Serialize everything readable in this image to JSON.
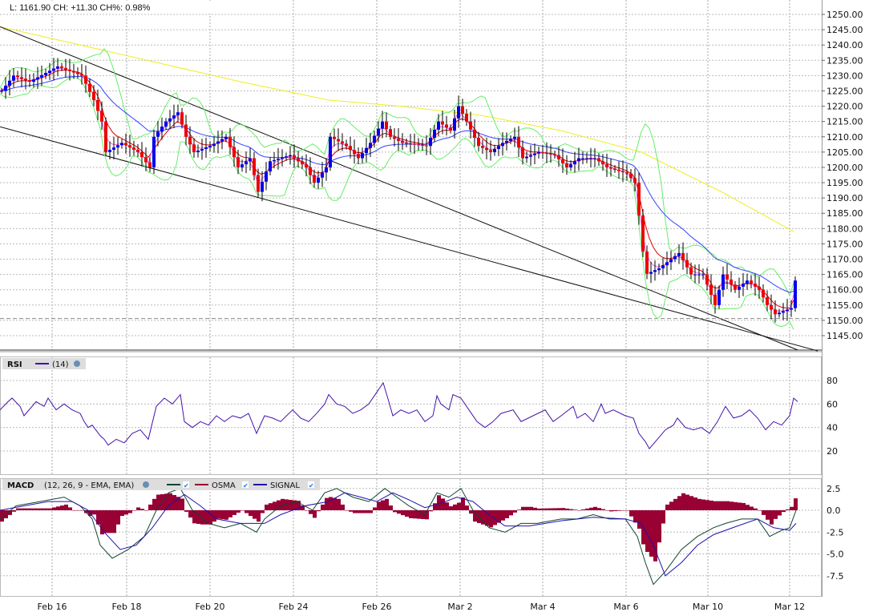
{
  "header": {
    "quote": "L: 1161.90 CH: +11.30 CH%: 0.98%"
  },
  "rsi_legend": {
    "title": "RSI",
    "params": "(14)"
  },
  "macd_legend": {
    "title": "MACD",
    "params": "(12, 26, 9 - EMA, EMA)",
    "osma": "OSMA",
    "signal": "SIGNAL"
  },
  "colors": {
    "up": "#0000ee",
    "down": "#ee0000",
    "ema_fast": "#dd0000",
    "ema_slow": "#3344ff",
    "sma_long": "#eeee22",
    "bands": "#66ee66",
    "rsi": "#4411aa",
    "macd": "#114433",
    "signal": "#2211aa",
    "osma": "#990033"
  },
  "chart_data": [
    {
      "type": "candlestick",
      "title": "Price",
      "xunit": "bar index",
      "price_ticks": [
        "1250.00",
        "1245.00",
        "1240.00",
        "1235.00",
        "1230.00",
        "1225.00",
        "1220.00",
        "1215.00",
        "1210.00",
        "1205.00",
        "1200.00",
        "1195.00",
        "1190.00",
        "1185.00",
        "1180.00",
        "1175.00",
        "1170.00",
        "1165.00",
        "1160.00",
        "1155.00",
        "1150.00",
        "1145.00"
      ],
      "ylim": [
        1140,
        1252
      ],
      "close": [
        [
          0,
          1225
        ],
        [
          3,
          1230
        ],
        [
          7,
          1228
        ],
        [
          14,
          1233
        ],
        [
          20,
          1230
        ],
        [
          23,
          1222
        ],
        [
          25,
          1215
        ],
        [
          26,
          1205
        ],
        [
          30,
          1208
        ],
        [
          34,
          1205
        ],
        [
          37,
          1200
        ],
        [
          38,
          1210
        ],
        [
          41,
          1215
        ],
        [
          44,
          1218
        ],
        [
          46,
          1210
        ],
        [
          48,
          1205
        ],
        [
          52,
          1207
        ],
        [
          56,
          1210
        ],
        [
          59,
          1200
        ],
        [
          62,
          1203
        ],
        [
          64,
          1192
        ],
        [
          67,
          1202
        ],
        [
          72,
          1204
        ],
        [
          76,
          1200
        ],
        [
          78,
          1195
        ],
        [
          81,
          1200
        ],
        [
          82,
          1210
        ],
        [
          86,
          1207
        ],
        [
          89,
          1203
        ],
        [
          92,
          1208
        ],
        [
          95,
          1215
        ],
        [
          97,
          1210
        ],
        [
          100,
          1208
        ],
        [
          106,
          1207
        ],
        [
          109,
          1215
        ],
        [
          112,
          1212
        ],
        [
          114,
          1220
        ],
        [
          116,
          1215
        ],
        [
          119,
          1207
        ],
        [
          122,
          1205
        ],
        [
          125,
          1208
        ],
        [
          128,
          1210
        ],
        [
          130,
          1203
        ],
        [
          134,
          1205
        ],
        [
          138,
          1204
        ],
        [
          141,
          1200
        ],
        [
          144,
          1203
        ],
        [
          148,
          1203
        ],
        [
          151,
          1200
        ],
        [
          156,
          1198
        ],
        [
          158,
          1195
        ],
        [
          159.4,
          1180
        ],
        [
          160.6,
          1165
        ],
        [
          164,
          1167
        ],
        [
          169,
          1172
        ],
        [
          172,
          1165
        ],
        [
          175,
          1165
        ],
        [
          178,
          1155
        ],
        [
          180,
          1165
        ],
        [
          183,
          1160
        ],
        [
          186,
          1163
        ],
        [
          189,
          1160
        ],
        [
          191,
          1155
        ],
        [
          193,
          1152
        ],
        [
          195,
          1153
        ],
        [
          197,
          1154
        ],
        [
          198,
          1163
        ]
      ],
      "sma_long": [
        [
          0,
          1246
        ],
        [
          30,
          1237
        ],
        [
          60,
          1228
        ],
        [
          82,
          1222
        ],
        [
          100,
          1220
        ],
        [
          120,
          1217
        ],
        [
          140,
          1212
        ],
        [
          160,
          1205
        ],
        [
          180,
          1192
        ],
        [
          198,
          1179
        ]
      ],
      "trendlines": [
        [
          [
            0,
            1246
          ],
          [
            199,
            1140.3
          ]
        ],
        [
          [
            0,
            1213.3
          ],
          [
            204,
            1140
          ]
        ]
      ],
      "prev_close": 1150.6
    },
    {
      "type": "line",
      "title": "RSI (14)",
      "ylim": [
        0,
        100
      ],
      "ticks": [
        "80",
        "60",
        "40",
        "20"
      ],
      "values": [
        [
          0,
          55
        ],
        [
          2,
          62
        ],
        [
          3,
          65
        ],
        [
          5,
          58
        ],
        [
          6,
          50
        ],
        [
          9,
          62
        ],
        [
          11,
          58
        ],
        [
          12,
          65
        ],
        [
          14,
          55
        ],
        [
          16,
          60
        ],
        [
          18,
          55
        ],
        [
          20,
          52
        ],
        [
          21,
          45
        ],
        [
          22,
          40
        ],
        [
          23,
          42
        ],
        [
          25,
          33
        ],
        [
          26,
          30
        ],
        [
          27,
          25
        ],
        [
          29,
          30
        ],
        [
          31,
          27
        ],
        [
          33,
          35
        ],
        [
          35,
          38
        ],
        [
          37,
          30
        ],
        [
          39,
          58
        ],
        [
          41,
          65
        ],
        [
          43,
          60
        ],
        [
          45,
          68
        ],
        [
          46,
          45
        ],
        [
          48,
          40
        ],
        [
          50,
          45
        ],
        [
          52,
          42
        ],
        [
          54,
          50
        ],
        [
          56,
          45
        ],
        [
          58,
          50
        ],
        [
          60,
          48
        ],
        [
          62,
          52
        ],
        [
          64,
          35
        ],
        [
          66,
          50
        ],
        [
          68,
          48
        ],
        [
          70,
          45
        ],
        [
          73,
          55
        ],
        [
          75,
          48
        ],
        [
          77,
          45
        ],
        [
          79,
          52
        ],
        [
          81,
          60
        ],
        [
          82,
          68
        ],
        [
          84,
          60
        ],
        [
          86,
          58
        ],
        [
          88,
          52
        ],
        [
          90,
          55
        ],
        [
          92,
          60
        ],
        [
          94,
          70
        ],
        [
          95.6,
          78
        ],
        [
          97,
          62
        ],
        [
          98,
          50
        ],
        [
          100,
          55
        ],
        [
          102,
          52
        ],
        [
          104,
          55
        ],
        [
          106,
          45
        ],
        [
          108,
          50
        ],
        [
          109,
          67
        ],
        [
          110,
          60
        ],
        [
          112,
          55
        ],
        [
          113,
          68
        ],
        [
          115,
          65
        ],
        [
          117,
          55
        ],
        [
          119,
          45
        ],
        [
          121,
          40
        ],
        [
          123,
          45
        ],
        [
          125,
          52
        ],
        [
          128,
          55
        ],
        [
          130,
          45
        ],
        [
          133,
          50
        ],
        [
          136,
          55
        ],
        [
          138,
          45
        ],
        [
          140,
          50
        ],
        [
          143,
          58
        ],
        [
          144,
          48
        ],
        [
          146,
          52
        ],
        [
          148,
          45
        ],
        [
          150,
          60
        ],
        [
          151,
          52
        ],
        [
          153,
          55
        ],
        [
          156,
          50
        ],
        [
          158,
          48
        ],
        [
          159.4,
          35
        ],
        [
          161,
          28
        ],
        [
          162,
          22
        ],
        [
          164,
          30
        ],
        [
          166,
          38
        ],
        [
          168,
          42
        ],
        [
          169,
          48
        ],
        [
          171,
          40
        ],
        [
          173,
          38
        ],
        [
          175,
          40
        ],
        [
          177,
          35
        ],
        [
          179,
          45
        ],
        [
          181,
          58
        ],
        [
          183,
          48
        ],
        [
          185,
          50
        ],
        [
          187,
          55
        ],
        [
          189,
          48
        ],
        [
          191,
          38
        ],
        [
          193,
          45
        ],
        [
          195,
          42
        ],
        [
          197,
          50
        ],
        [
          198,
          65
        ],
        [
          199,
          62
        ]
      ]
    },
    {
      "type": "line",
      "title": "MACD (12, 26, 9 - EMA, EMA)",
      "ylim": [
        -10,
        3.5
      ],
      "ticks": [
        "2.5",
        "0.0",
        "-2.5",
        "-5.0",
        "-7.5"
      ],
      "macd": [
        [
          0,
          -1
        ],
        [
          4,
          0.5
        ],
        [
          10,
          1
        ],
        [
          16,
          1.5
        ],
        [
          20,
          0.5
        ],
        [
          23,
          -1
        ],
        [
          25,
          -4
        ],
        [
          28,
          -5.5
        ],
        [
          32,
          -4.5
        ],
        [
          36,
          -3
        ],
        [
          39,
          0
        ],
        [
          42,
          2
        ],
        [
          45,
          2.5
        ],
        [
          48,
          0
        ],
        [
          52,
          -1.5
        ],
        [
          56,
          -2
        ],
        [
          60,
          -1.5
        ],
        [
          64,
          -2.5
        ],
        [
          66,
          -1
        ],
        [
          70,
          0.5
        ],
        [
          74,
          1
        ],
        [
          78,
          0
        ],
        [
          81,
          2
        ],
        [
          84,
          2.5
        ],
        [
          88,
          1.5
        ],
        [
          92,
          1
        ],
        [
          96,
          2.5
        ],
        [
          99,
          1.5
        ],
        [
          102,
          0.5
        ],
        [
          106,
          -0.5
        ],
        [
          109,
          2
        ],
        [
          112,
          1.5
        ],
        [
          115,
          2.5
        ],
        [
          118,
          0
        ],
        [
          122,
          -2
        ],
        [
          126,
          -2.5
        ],
        [
          130,
          -1.5
        ],
        [
          134,
          -1.5
        ],
        [
          140,
          -1
        ],
        [
          144,
          -1
        ],
        [
          148,
          -0.5
        ],
        [
          152,
          -1
        ],
        [
          156,
          -1
        ],
        [
          159,
          -3
        ],
        [
          161,
          -6
        ],
        [
          163,
          -8.5
        ],
        [
          166,
          -7
        ],
        [
          170,
          -4.5
        ],
        [
          174,
          -3
        ],
        [
          178,
          -2
        ],
        [
          181,
          -1.5
        ],
        [
          185,
          -1
        ],
        [
          189,
          -1
        ],
        [
          192,
          -3
        ],
        [
          195,
          -2.3
        ],
        [
          197,
          -2
        ],
        [
          198.6,
          0
        ]
      ],
      "signal": [
        [
          0,
          0
        ],
        [
          6,
          0.5
        ],
        [
          12,
          1
        ],
        [
          18,
          1
        ],
        [
          22,
          0
        ],
        [
          26,
          -2.5
        ],
        [
          30,
          -4.5
        ],
        [
          34,
          -4
        ],
        [
          38,
          -2
        ],
        [
          42,
          0.5
        ],
        [
          46,
          1.8
        ],
        [
          50,
          0.5
        ],
        [
          54,
          -1
        ],
        [
          60,
          -1.5
        ],
        [
          66,
          -1.5
        ],
        [
          70,
          -0.5
        ],
        [
          76,
          0.5
        ],
        [
          82,
          1
        ],
        [
          86,
          2
        ],
        [
          90,
          1.5
        ],
        [
          94,
          1
        ],
        [
          98,
          2
        ],
        [
          102,
          1.2
        ],
        [
          106,
          0.3
        ],
        [
          110,
          0.8
        ],
        [
          114,
          1.5
        ],
        [
          118,
          1
        ],
        [
          122,
          -0.5
        ],
        [
          126,
          -1.8
        ],
        [
          132,
          -1.8
        ],
        [
          140,
          -1.2
        ],
        [
          148,
          -0.8
        ],
        [
          156,
          -1
        ],
        [
          160,
          -1.5
        ],
        [
          163,
          -4
        ],
        [
          166,
          -7.5
        ],
        [
          170,
          -6
        ],
        [
          174,
          -4
        ],
        [
          178,
          -2.8
        ],
        [
          184,
          -1.8
        ],
        [
          189,
          -1
        ],
        [
          193,
          -2
        ],
        [
          197,
          -2.3
        ],
        [
          198.6,
          -1.5
        ]
      ]
    },
    {
      "type": "axis",
      "x_ticks": [
        {
          "t": 13,
          "label": "Feb 16"
        },
        {
          "t": 31.6,
          "label": "Feb 18"
        },
        {
          "t": 52.4,
          "label": "Feb 20"
        },
        {
          "t": 73.2,
          "label": "Feb 24"
        },
        {
          "t": 94,
          "label": "Feb 26"
        },
        {
          "t": 114.8,
          "label": "Mar 2"
        },
        {
          "t": 135.4,
          "label": "Mar 4"
        },
        {
          "t": 156.2,
          "label": "Mar 6"
        },
        {
          "t": 176.6,
          "label": "Mar 10"
        },
        {
          "t": 197,
          "label": "Mar 12"
        }
      ]
    }
  ]
}
